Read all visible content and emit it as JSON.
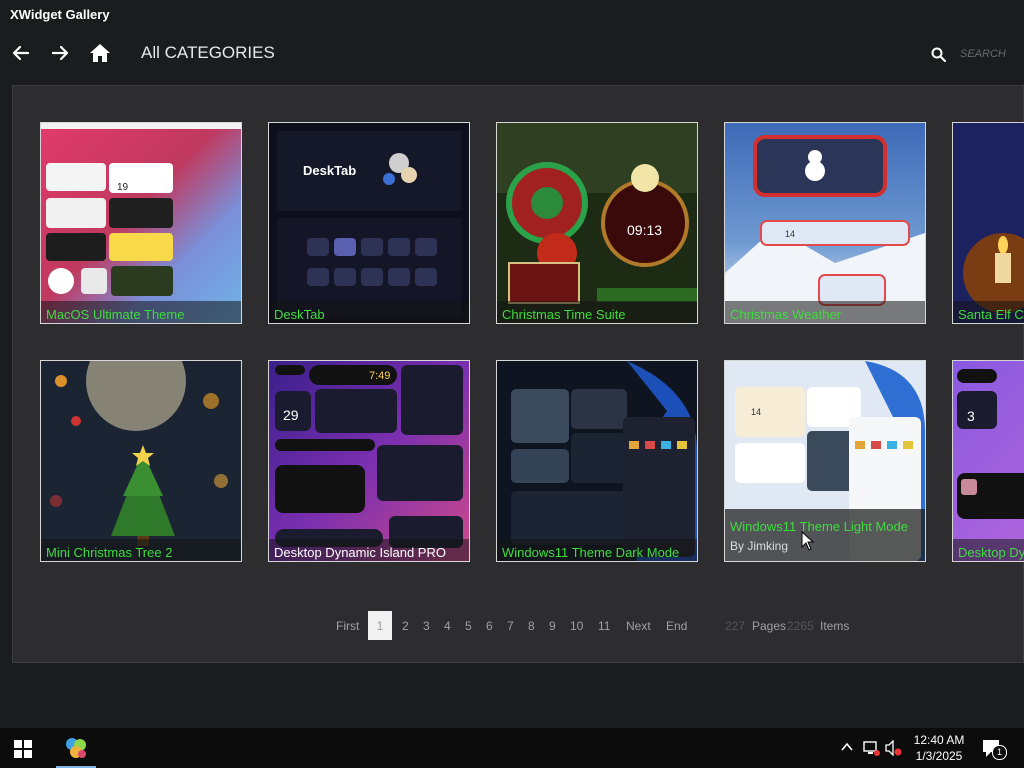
{
  "app": {
    "title": "XWidget Gallery"
  },
  "nav": {
    "back_icon": "arrow-left-icon",
    "forward_icon": "arrow-right-icon",
    "home_icon": "home-icon",
    "title": "All CATEGORIES"
  },
  "search": {
    "icon": "search-icon",
    "placeholder": "SEARCH",
    "value": ""
  },
  "gallery": {
    "name_color": "#3fdc3f",
    "items": [
      {
        "name": "MacOS Ultimate Theme"
      },
      {
        "name": "DeskTab"
      },
      {
        "name": "Christmas Time Suite"
      },
      {
        "name": "Christmas Weather"
      },
      {
        "name": "Santa Elf C"
      },
      {
        "name": "Mini Christmas Tree 2"
      },
      {
        "name": "Desktop Dynamic Island PRO"
      },
      {
        "name": "Windows11 Theme Dark Mode"
      },
      {
        "name": "Windows11 Theme Light Mode",
        "author": "By Jimking"
      },
      {
        "name": "Desktop Dy"
      }
    ],
    "thumb_labels": {
      "desktab_title": "DeskTab",
      "christmas_clock": "09:13",
      "mac_date": "19",
      "island_time": "7:49",
      "island_date": "29",
      "weather_temp": "14",
      "light_temp": "14",
      "dy_num": "3"
    }
  },
  "pager": {
    "first": "First",
    "current": "1",
    "pages": [
      "2",
      "3",
      "4",
      "5",
      "6",
      "7",
      "8",
      "9",
      "10",
      "11"
    ],
    "next": "Next",
    "end": "End",
    "total_pages": "227",
    "pages_label": "Pages",
    "total_items": "2265",
    "items_label": "Items"
  },
  "taskbar": {
    "start_icon": "windows-start-icon",
    "app_icon": "xwidget-app-icon",
    "tray": {
      "chevron_icon": "chevron-up-icon",
      "network_icon": "network-icon",
      "volume_icon": "volume-muted-icon"
    },
    "time": "12:40 AM",
    "date": "1/3/2025",
    "notification_icon": "notification-icon",
    "notification_count": "1"
  }
}
